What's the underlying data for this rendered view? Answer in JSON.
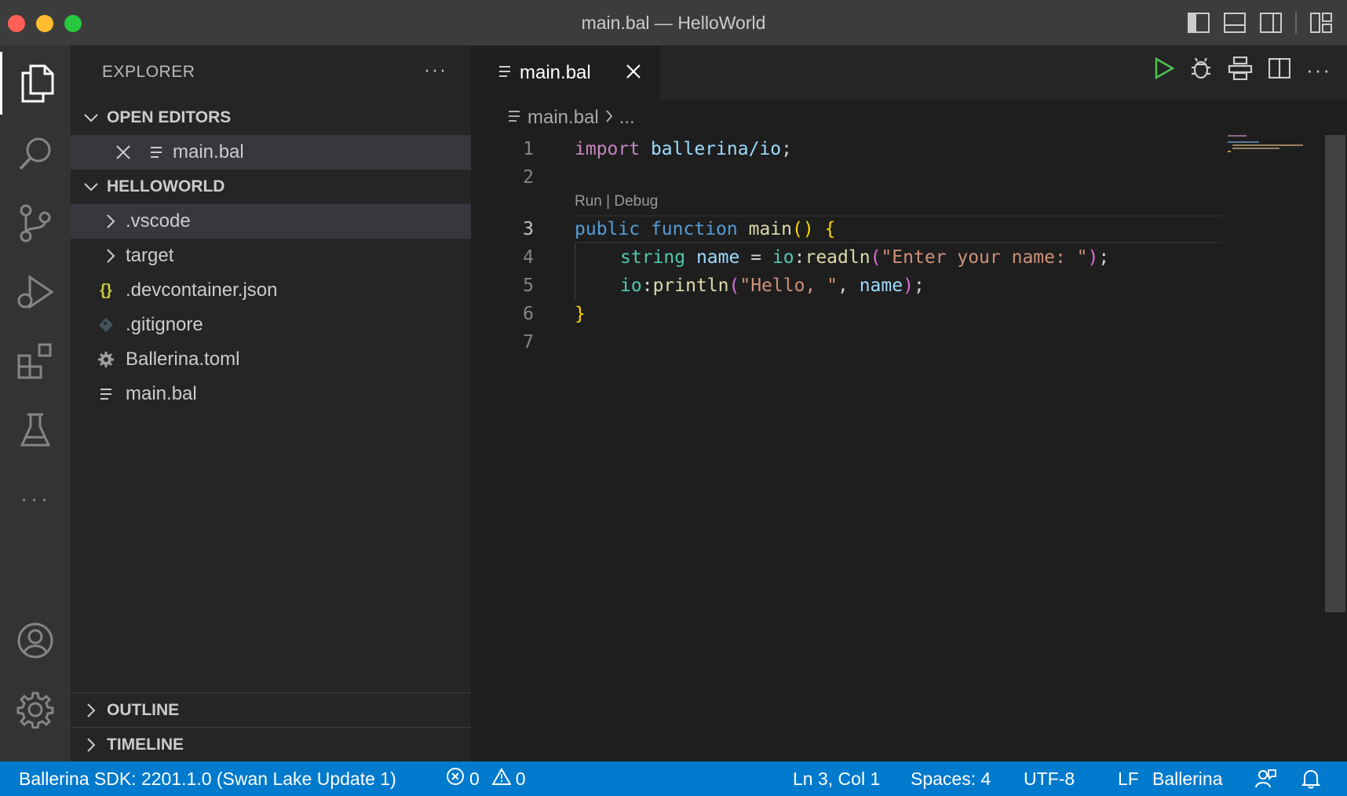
{
  "window": {
    "title": "main.bal — HelloWorld",
    "traffic_colors": {
      "close": "#ff5f57",
      "minimize": "#febc2e",
      "maximize": "#28c840"
    }
  },
  "titlebar_icons": [
    "toggle-primary-sidebar-icon",
    "toggle-panel-icon",
    "toggle-secondary-sidebar-icon",
    "customize-layout-icon"
  ],
  "activity_bar": [
    "explorer-icon",
    "search-icon",
    "source-control-icon",
    "run-debug-icon",
    "extensions-icon",
    "testing-icon",
    "more-icon",
    "accounts-icon",
    "manage-gear-icon"
  ],
  "sidebar": {
    "header": "EXPLORER",
    "more": "···",
    "open_editors": {
      "label": "OPEN EDITORS",
      "items": [
        {
          "name": "main.bal"
        }
      ]
    },
    "project": {
      "label": "HELLOWORLD",
      "items": [
        {
          "name": ".vscode",
          "kind": "folder"
        },
        {
          "name": "target",
          "kind": "folder"
        },
        {
          "name": ".devcontainer.json",
          "kind": "json",
          "icon_text": "{}"
        },
        {
          "name": ".gitignore",
          "kind": "git"
        },
        {
          "name": "Ballerina.toml",
          "kind": "toml"
        },
        {
          "name": "main.bal",
          "kind": "bal"
        }
      ]
    },
    "outline_label": "OUTLINE",
    "timeline_label": "TIMELINE"
  },
  "editor": {
    "tab_label": "main.bal",
    "breadcrumb": {
      "file": "main.bal",
      "rest": "..."
    },
    "codelens": "Run | Debug",
    "current_line": 3,
    "lines": [
      {
        "n": "1"
      },
      {
        "n": "2"
      },
      {
        "n": "3"
      },
      {
        "n": "4"
      },
      {
        "n": "5"
      },
      {
        "n": "6"
      },
      {
        "n": "7"
      }
    ],
    "code": {
      "l1": {
        "kw": "import",
        "mod": "ballerina/io",
        "semi": ";"
      },
      "l3": {
        "kw1": "public",
        "kw2": "function",
        "fn": "main",
        "parens": "()",
        "brace": "{"
      },
      "l4": {
        "type": "string",
        "var": "name",
        "eq": "=",
        "mod": "io",
        "colon": ":",
        "fn": "readln",
        "open": "(",
        "str": "\"Enter your name: \"",
        "close": ")",
        "semi": ";"
      },
      "l5": {
        "mod": "io",
        "colon": ":",
        "fn": "println",
        "open": "(",
        "str": "\"Hello, \"",
        "comma": ",",
        "var": "name",
        "close": ")",
        "semi": ";"
      },
      "l6": {
        "brace": "}"
      }
    }
  },
  "status_bar": {
    "sdk": "Ballerina SDK: 2201.1.0 (Swan Lake Update 1)",
    "errors": "0",
    "warnings": "0",
    "position": "Ln 3, Col 1",
    "spaces": "Spaces: 4",
    "encoding": "UTF-8",
    "eol": "LF",
    "language": "Ballerina"
  }
}
